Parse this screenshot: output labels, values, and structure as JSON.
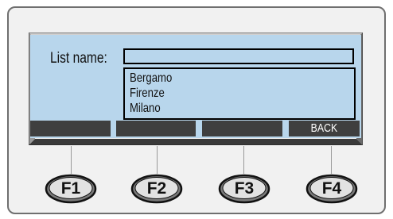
{
  "form": {
    "list_name_label": "List name:",
    "list_name_value": ""
  },
  "list": {
    "items": [
      "Bergamo",
      "Firenze",
      "Milano"
    ]
  },
  "softkeys": [
    {
      "label": ""
    },
    {
      "label": ""
    },
    {
      "label": ""
    },
    {
      "label": "BACK"
    }
  ],
  "function_keys": [
    {
      "label": "F1"
    },
    {
      "label": "F2"
    },
    {
      "label": "F3"
    },
    {
      "label": "F4"
    }
  ],
  "colors": {
    "lcd_background": "#b8d6ec",
    "softkey_background": "#3f3f3f",
    "frame_background": "#f1f1f1"
  }
}
